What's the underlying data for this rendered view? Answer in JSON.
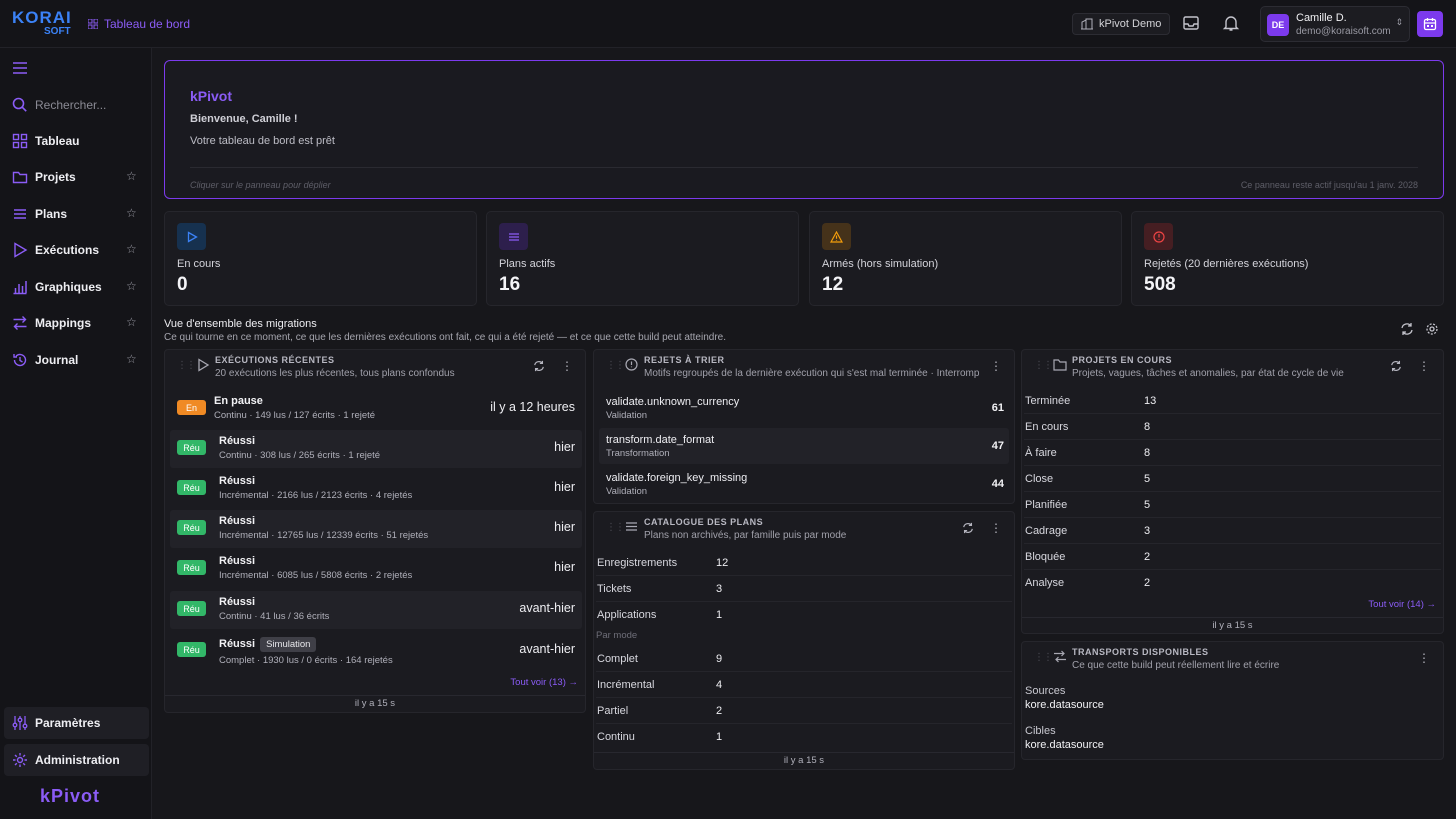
{
  "brand": {
    "logo_top": "KORAI",
    "logo_bottom": "SOFT",
    "footer_logo": "kPivot"
  },
  "header": {
    "breadcrumb": "Tableau de bord",
    "tenant": "kPivot Demo",
    "user": {
      "initials": "DE",
      "name": "Camille D.",
      "email": "demo@koraisoft.com"
    }
  },
  "sidebar": {
    "search_placeholder": "Rechercher...",
    "items": [
      {
        "label": "Tableau",
        "icon": "grid-icon"
      },
      {
        "label": "Projets",
        "icon": "folder-icon"
      },
      {
        "label": "Plans",
        "icon": "list-icon"
      },
      {
        "label": "Exécutions",
        "icon": "play-icon"
      },
      {
        "label": "Graphiques",
        "icon": "bar-chart-icon"
      },
      {
        "label": "Mappings",
        "icon": "arrows-icon"
      },
      {
        "label": "Journal",
        "icon": "history-icon"
      }
    ],
    "bottom": [
      {
        "label": "Paramètres",
        "icon": "sliders-icon"
      },
      {
        "label": "Administration",
        "icon": "gear-icon"
      }
    ]
  },
  "welcome": {
    "title": "kPivot",
    "greeting": "Bienvenue, Camille !",
    "message": "Votre tableau de bord est prêt",
    "hint": "Cliquer sur le panneau pour déplier",
    "expiry": "Ce panneau reste actif jusqu'au 1 janv. 2028"
  },
  "kpis": [
    {
      "label": "En cours",
      "value": "0",
      "color": "#3b82f6"
    },
    {
      "label": "Plans actifs",
      "value": "16",
      "color": "#8b5cf6"
    },
    {
      "label": "Armés (hors simulation)",
      "value": "12",
      "color": "#f59e0b"
    },
    {
      "label": "Rejetés (20 dernières exécutions)",
      "value": "508",
      "color": "#ef4444"
    }
  ],
  "overview": {
    "title": "Vue d'ensemble des migrations",
    "subtitle": "Ce qui tourne en ce moment, ce que les dernières exécutions ont fait, ce qui a été rejeté — et ce que cette build peut atteindre."
  },
  "executions": {
    "title": "EXÉCUTIONS RÉCENTES",
    "subtitle": "20 exécutions les plus récentes, tous plans confondus",
    "rows": [
      {
        "badge": "En",
        "status": "En pause",
        "detail": "Continu · 149 lus / 127 écrits · 1 rejeté",
        "when": "il y a 12 heures"
      },
      {
        "badge": "Réu",
        "status": "Réussi",
        "detail": "Continu · 308 lus / 265 écrits · 1 rejeté",
        "when": "hier"
      },
      {
        "badge": "Réu",
        "status": "Réussi",
        "detail": "Incrémental · 2166 lus / 2123 écrits · 4 rejetés",
        "when": "hier"
      },
      {
        "badge": "Réu",
        "status": "Réussi",
        "detail": "Incrémental · 12765 lus / 12339 écrits · 51 rejetés",
        "when": "hier"
      },
      {
        "badge": "Réu",
        "status": "Réussi",
        "detail": "Incrémental · 6085 lus / 5808 écrits · 2 rejetés",
        "when": "hier"
      },
      {
        "badge": "Réu",
        "status": "Réussi",
        "detail": "Continu · 41 lus / 36 écrits",
        "when": "avant-hier"
      },
      {
        "badge": "Réu",
        "status": "Réussi",
        "detail": "Complet · 1930 lus / 0 écrits · 164 rejetés",
        "when": "avant-hier",
        "tag": "Simulation"
      }
    ],
    "see_all": "Tout voir (13) →",
    "updated": "il y a 15 s"
  },
  "rejects": {
    "title": "REJETS À TRIER",
    "subtitle": "Motifs regroupés de la dernière exécution qui s'est mal terminée · Interrompu",
    "rows": [
      {
        "code": "validate.unknown_currency",
        "category": "Validation",
        "count": "61"
      },
      {
        "code": "transform.date_format",
        "category": "Transformation",
        "count": "47"
      },
      {
        "code": "validate.foreign_key_missing",
        "category": "Validation",
        "count": "44"
      }
    ]
  },
  "catalog": {
    "title": "CATALOGUE DES PLANS",
    "subtitle": "Plans non archivés, par famille puis par mode",
    "families": [
      {
        "k": "Enregistrements",
        "v": "12"
      },
      {
        "k": "Tickets",
        "v": "3"
      },
      {
        "k": "Applications",
        "v": "1"
      }
    ],
    "mode_label": "Par mode",
    "modes": [
      {
        "k": "Complet",
        "v": "9"
      },
      {
        "k": "Incrémental",
        "v": "4"
      },
      {
        "k": "Partiel",
        "v": "2"
      },
      {
        "k": "Continu",
        "v": "1"
      }
    ],
    "updated": "il y a 15 s"
  },
  "projects": {
    "title": "PROJETS EN COURS",
    "subtitle": "Projets, vagues, tâches et anomalies, par état de cycle de vie",
    "rows": [
      {
        "k": "Terminée",
        "v": "13"
      },
      {
        "k": "En cours",
        "v": "8"
      },
      {
        "k": "À faire",
        "v": "8"
      },
      {
        "k": "Close",
        "v": "5"
      },
      {
        "k": "Planifiée",
        "v": "5"
      },
      {
        "k": "Cadrage",
        "v": "3"
      },
      {
        "k": "Bloquée",
        "v": "2"
      },
      {
        "k": "Analyse",
        "v": "2"
      }
    ],
    "see_all": "Tout voir (14) →",
    "updated": "il y a 15 s"
  },
  "transports": {
    "title": "TRANSPORTS DISPONIBLES",
    "subtitle": "Ce que cette build peut réellement lire et écrire",
    "sources_label": "Sources",
    "sources_value": "kore.datasource",
    "targets_label": "Cibles",
    "targets_value": "kore.datasource"
  }
}
